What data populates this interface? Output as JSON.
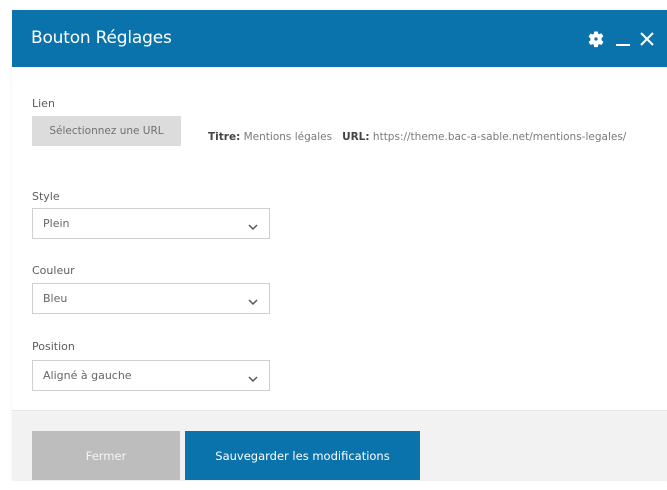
{
  "dialog": {
    "title": "Bouton Réglages",
    "controls": {
      "settings_icon": "gear-icon",
      "minimize_icon": "minimize-icon",
      "close_icon": "close-icon"
    }
  },
  "link": {
    "label": "Lien",
    "select_url_button": "Sélectionnez une URL",
    "title_label": "Titre:",
    "title_value": "Mentions légales",
    "url_label": "URL:",
    "url_value": "https://theme.bac-a-sable.net/mentions-legales/"
  },
  "style": {
    "label": "Style",
    "value": "Plein"
  },
  "color": {
    "label": "Couleur",
    "value": "Bleu"
  },
  "position": {
    "label": "Position",
    "value": "Aligné à gauche"
  },
  "footer": {
    "close_button": "Fermer",
    "save_button": "Sauvegarder les modifications"
  },
  "colors": {
    "accent": "#0b73ab",
    "disabled_button": "#bdbdbd",
    "footer_bg": "#f2f2f2"
  }
}
